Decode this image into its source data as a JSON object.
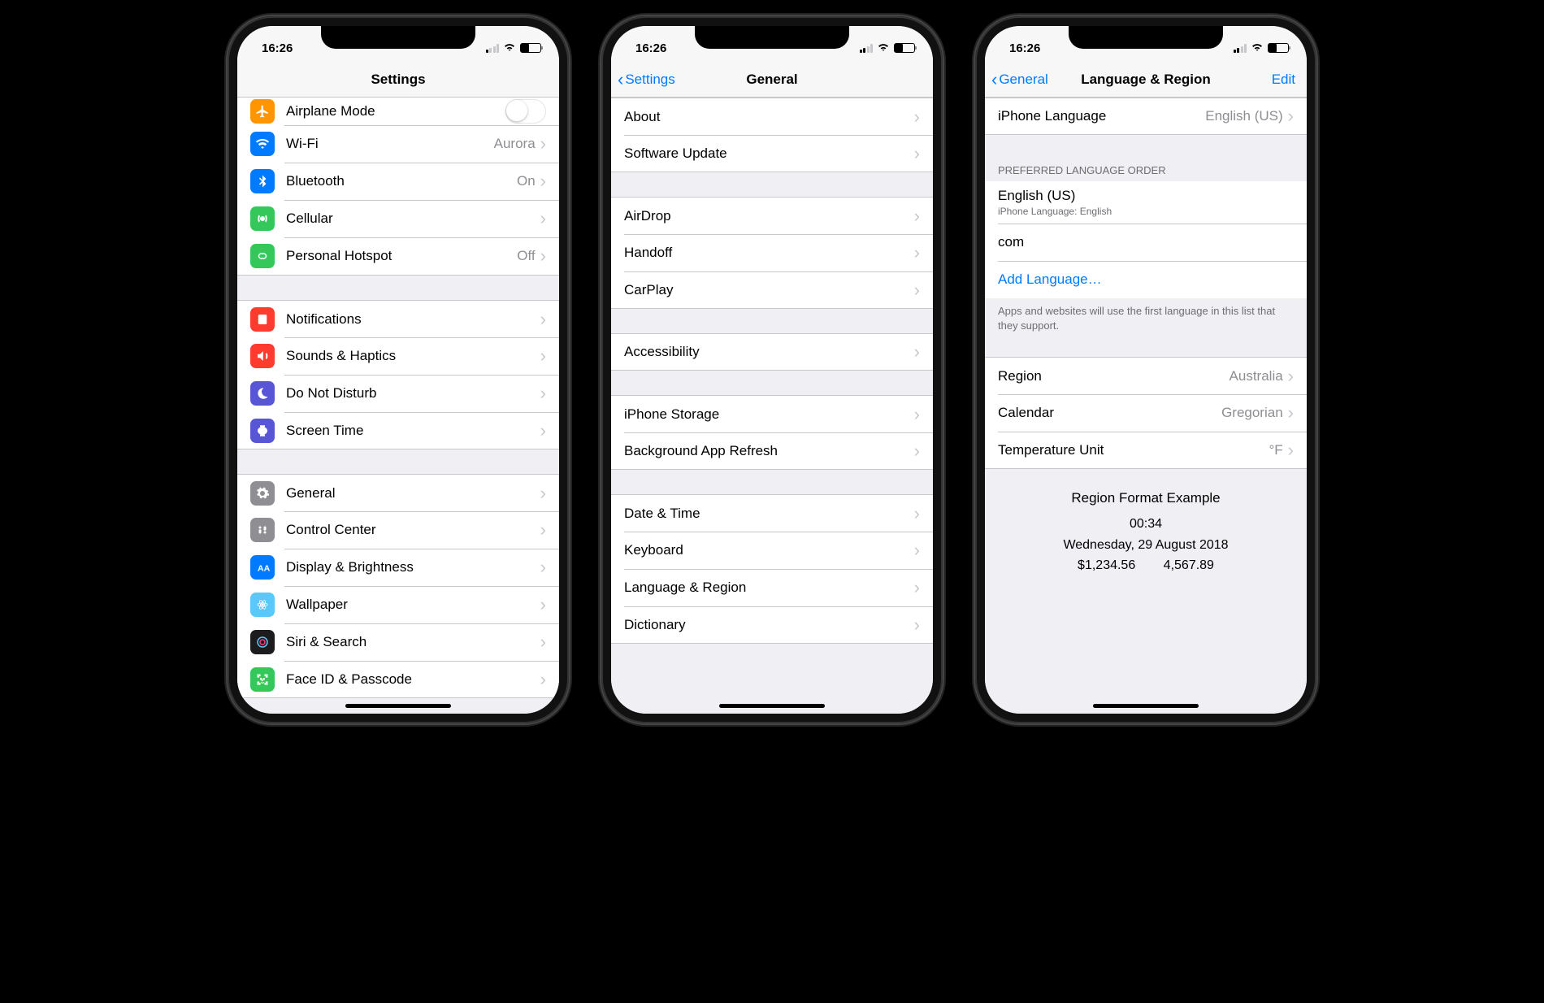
{
  "status": {
    "time": "16:26"
  },
  "colors": {
    "accent": "#007aff"
  },
  "phone1": {
    "title": "Settings",
    "partial": {
      "airplane": "Airplane Mode"
    },
    "g1": {
      "wifi": {
        "label": "Wi-Fi",
        "detail": "Aurora"
      },
      "bluetooth": {
        "label": "Bluetooth",
        "detail": "On"
      },
      "cellular": {
        "label": "Cellular"
      },
      "hotspot": {
        "label": "Personal Hotspot",
        "detail": "Off"
      }
    },
    "g2": {
      "notifications": "Notifications",
      "sounds": "Sounds & Haptics",
      "dnd": "Do Not Disturb",
      "screentime": "Screen Time"
    },
    "g3": {
      "general": "General",
      "control": "Control Center",
      "display": "Display & Brightness",
      "wallpaper": "Wallpaper",
      "siri": "Siri & Search",
      "faceid": "Face ID & Passcode"
    }
  },
  "phone2": {
    "back": "Settings",
    "title": "General",
    "g1": {
      "about": "About",
      "update": "Software Update"
    },
    "g2": {
      "airdrop": "AirDrop",
      "handoff": "Handoff",
      "carplay": "CarPlay"
    },
    "g3": {
      "accessibility": "Accessibility"
    },
    "g4": {
      "storage": "iPhone Storage",
      "bgrefresh": "Background App Refresh"
    },
    "g5": {
      "datetime": "Date & Time",
      "keyboard": "Keyboard",
      "langregion": "Language & Region",
      "dictionary": "Dictionary"
    }
  },
  "phone3": {
    "back": "General",
    "title": "Language & Region",
    "edit": "Edit",
    "iphoneLang": {
      "label": "iPhone Language",
      "detail": "English (US)"
    },
    "prefHeader": "PREFERRED LANGUAGE ORDER",
    "pref": {
      "item1": {
        "label": "English (US)",
        "sub": "iPhone Language: English"
      },
      "item2": {
        "label": "com"
      },
      "add": "Add Language…"
    },
    "prefFooter": "Apps and websites will use the first language in this list that they support.",
    "regionGroup": {
      "region": {
        "label": "Region",
        "detail": "Australia"
      },
      "calendar": {
        "label": "Calendar",
        "detail": "Gregorian"
      },
      "temp": {
        "label": "Temperature Unit",
        "detail": "°F"
      }
    },
    "example": {
      "title": "Region Format Example",
      "time": "00:34",
      "date": "Wednesday, 29 August 2018",
      "nums": "$1,234.56 4,567.89"
    }
  }
}
